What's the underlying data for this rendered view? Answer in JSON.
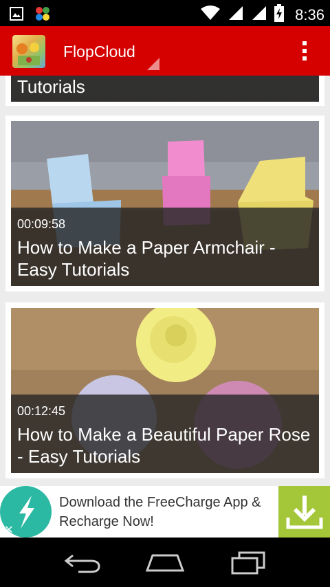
{
  "status_bar": {
    "time": "8:36",
    "icons": [
      "image-icon",
      "app-notification-icon",
      "wifi-icon",
      "signal-icon",
      "signal-icon-2",
      "battery-charging-icon"
    ]
  },
  "action_bar": {
    "title": "FlopCloud",
    "overflow_icon": "more-vert-icon"
  },
  "videos": [
    {
      "title": "Tutorials",
      "duration": ""
    },
    {
      "duration": "00:09:58",
      "title": "How to Make a Paper Armchair - Easy Tutorials"
    },
    {
      "duration": "00:12:45",
      "title": "How to Make a Beautiful Paper Rose - Easy Tutorials"
    }
  ],
  "ad": {
    "text": "Download the FreeCharge App & Recharge Now!",
    "close_label": "✕",
    "icons": [
      "freecharge-logo-icon",
      "download-icon"
    ]
  },
  "nav_bar": {
    "icons": [
      "back-icon",
      "home-icon",
      "recents-icon"
    ]
  }
}
